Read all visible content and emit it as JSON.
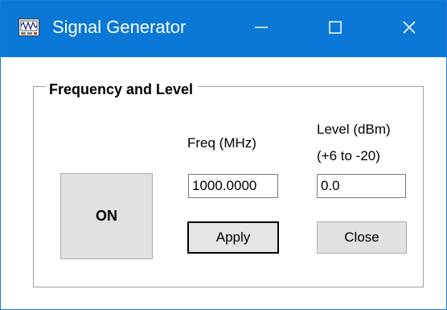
{
  "window": {
    "title": "Signal Generator",
    "controls": {
      "minimize": "—",
      "maximize": "☐",
      "close": "✕"
    },
    "icon": "signal-generator-app-icon",
    "accent_color": "#0a78d7"
  },
  "group": {
    "title": "Frequency and Level"
  },
  "freq": {
    "label": "Freq (MHz)",
    "value": "1000.0000"
  },
  "level": {
    "label_line1": "Level (dBm)",
    "label_line2": "(+6 to -20)",
    "value": "0.0"
  },
  "buttons": {
    "on": "ON",
    "apply": "Apply",
    "close": "Close"
  }
}
